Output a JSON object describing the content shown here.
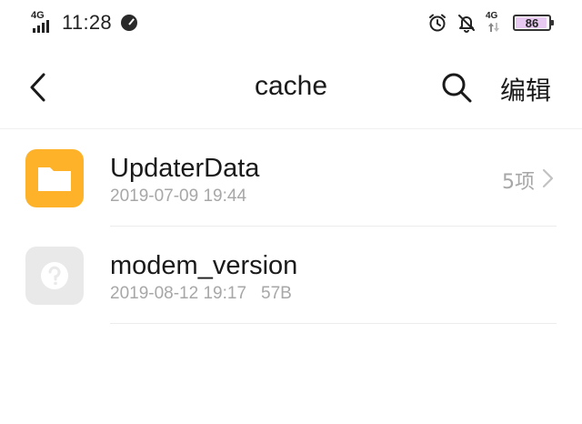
{
  "status_bar": {
    "network_left": "4G",
    "time": "11:28",
    "network_right": "4G",
    "battery": "86"
  },
  "header": {
    "title": "cache",
    "edit_label": "编辑"
  },
  "files": [
    {
      "name": "UpdaterData",
      "date": "2019-07-09 19:44",
      "size": "",
      "count": "5项",
      "type": "folder"
    },
    {
      "name": "modem_version",
      "date": "2019-08-12 19:17",
      "size": "57B",
      "count": "",
      "type": "unknown"
    }
  ],
  "colors": {
    "folder": "#fdb22a",
    "unknown_file": "#e9e9e9",
    "secondary_text": "#a7a7a7"
  }
}
